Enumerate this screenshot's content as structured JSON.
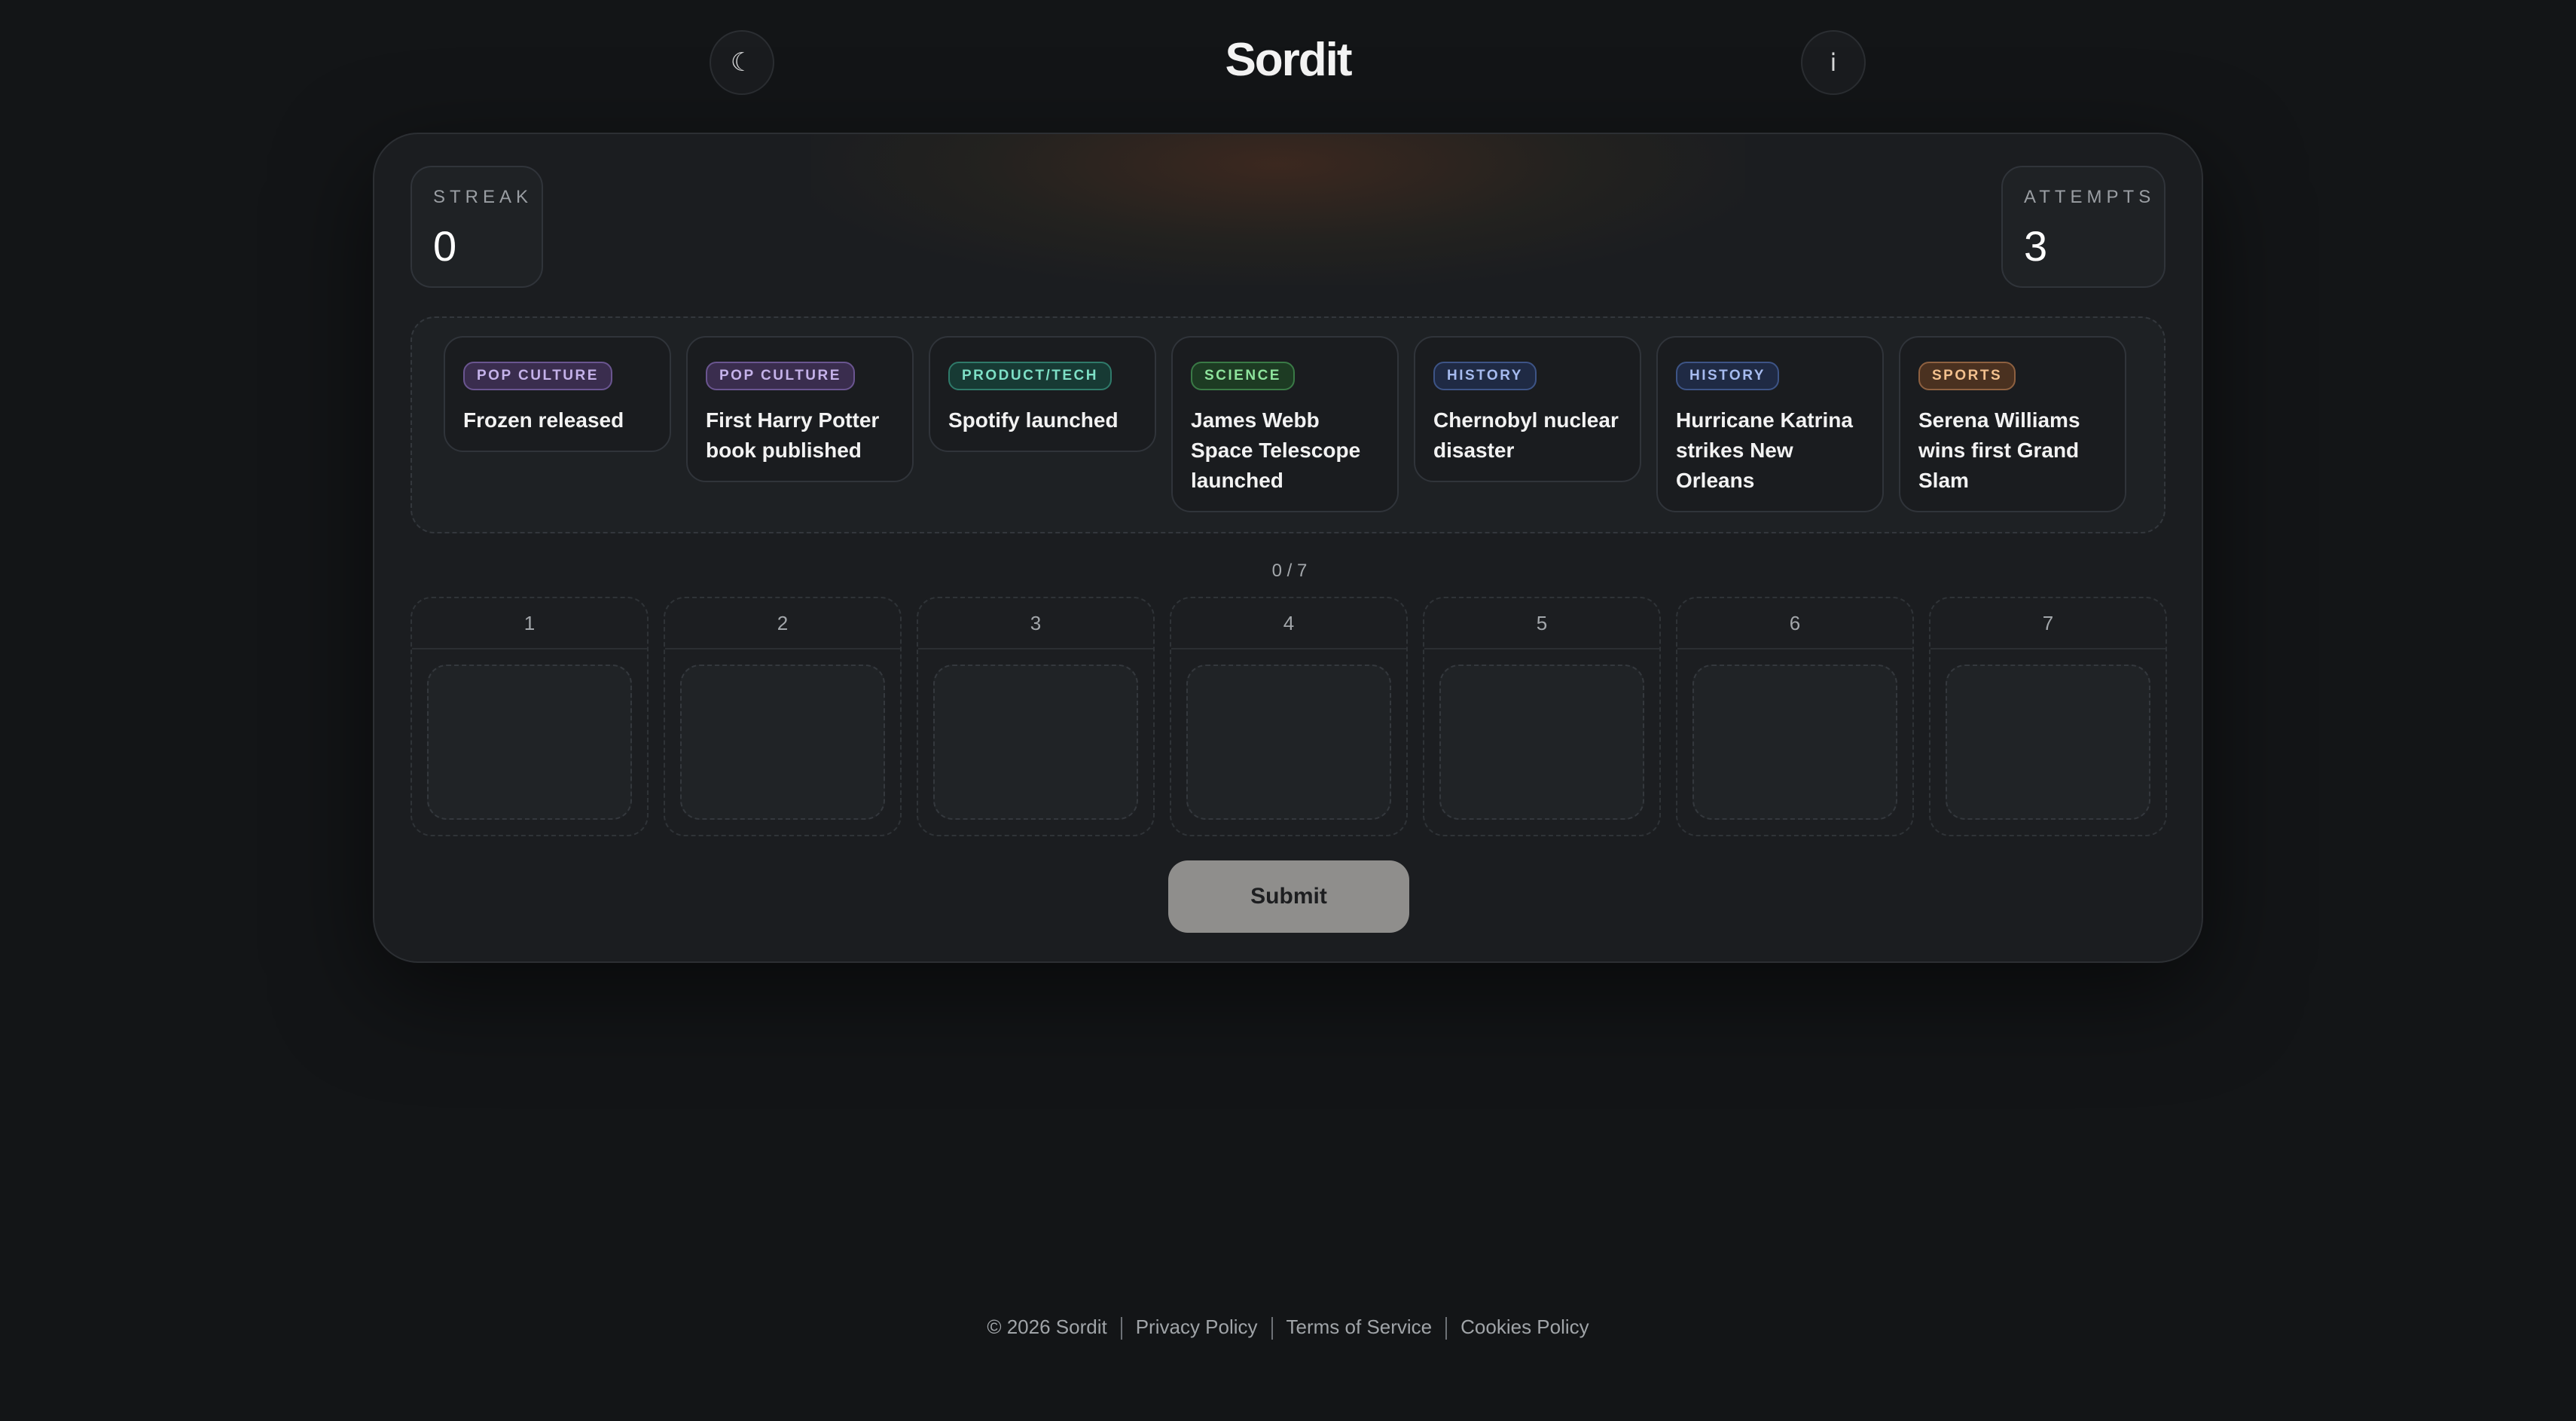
{
  "header": {
    "title": "Sordit",
    "theme_icon": "☾",
    "info_icon": "i"
  },
  "stats": {
    "streak_label": "STREAK",
    "streak_value": "0",
    "attempts_label": "ATTEMPTS",
    "attempts_value": "3"
  },
  "events": [
    {
      "category": "POP CULTURE",
      "text": "Frozen released"
    },
    {
      "category": "POP CULTURE",
      "text": "First Harry Potter book published"
    },
    {
      "category": "PRODUCT/TECH",
      "text": "Spotify launched"
    },
    {
      "category": "SCIENCE",
      "text": "James Webb Space Telescope launched"
    },
    {
      "category": "HISTORY",
      "text": "Chernobyl nuclear disaster"
    },
    {
      "category": "HISTORY",
      "text": "Hurricane Katrina strikes New Orleans"
    },
    {
      "category": "SPORTS",
      "text": "Serena Williams wins first Grand Slam"
    }
  ],
  "counter": "0 / 7",
  "slots": [
    "1",
    "2",
    "3",
    "4",
    "5",
    "6",
    "7"
  ],
  "submit_label": "Submit",
  "footer": {
    "copyright": "© 2026 Sordit",
    "links": [
      "Privacy Policy",
      "Terms of Service",
      "Cookies Policy"
    ]
  }
}
